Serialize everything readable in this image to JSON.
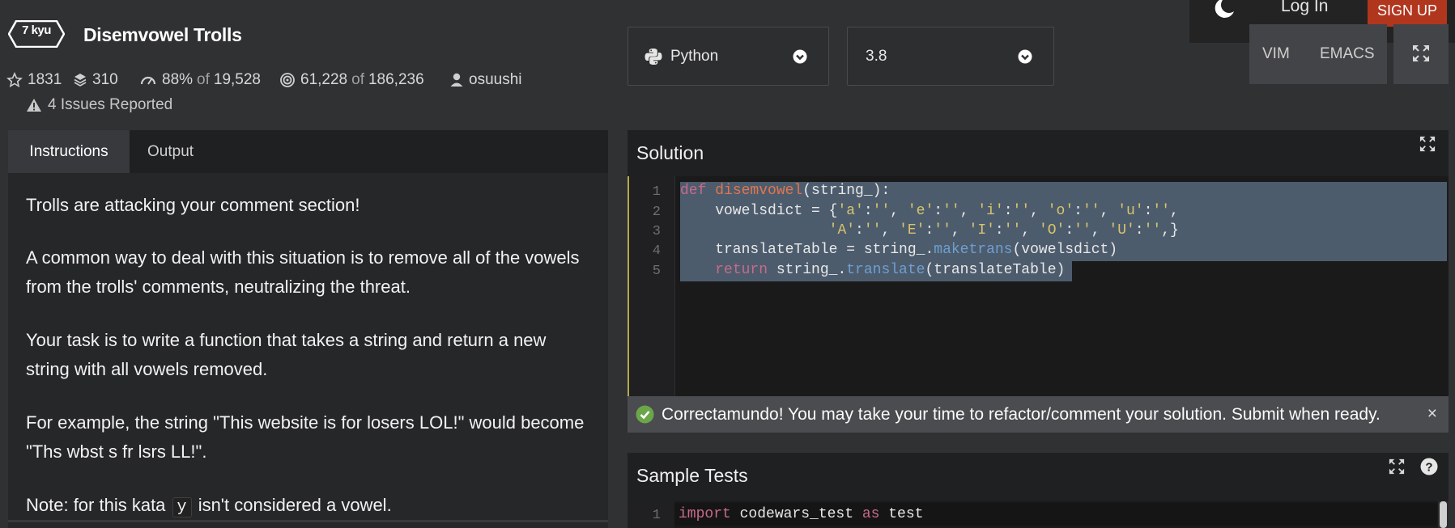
{
  "auth": {
    "login_label": "Log In",
    "signup_label": "SIGN UP",
    "theme_icon": "moon-icon"
  },
  "kata": {
    "rank": "7 kyu",
    "title": "Disemvowel Trolls",
    "stats": {
      "stars": "1831",
      "collections": "310",
      "satisfaction": "88%",
      "of1": "of",
      "votes": "19,528",
      "completed": "61,228",
      "of2": "of",
      "attempts": "186,236",
      "author": "osuushi"
    },
    "issues": "4 Issues Reported"
  },
  "language": {
    "selected": "Python",
    "version": "3.8"
  },
  "editor_modes": {
    "vim": "VIM",
    "emacs": "EMACS"
  },
  "tabs": {
    "instructions": "Instructions",
    "output": "Output"
  },
  "instructions": {
    "p1": "Trolls are attacking your comment section!",
    "p2a": "A common way to deal with this situation is to remove all of the vowels",
    "p2b": "from the trolls' comments, neutralizing the threat.",
    "p3a": "Your task is to write a function that takes a string and return a new",
    "p3b": "string with all vowels removed.",
    "p4a": "For example, the string \"This website is for losers LOL!\" would become",
    "p4b": "\"Ths wbst s fr lsrs LL!\".",
    "p5a": "Note: for this kata",
    "p5code": "y",
    "p5b": "isn't considered a vowel."
  },
  "solution": {
    "title": "Solution",
    "line_numbers": [
      "1",
      "2",
      "3",
      "4",
      "5"
    ],
    "code": {
      "l1_kw": "def",
      "l1_fn": "disemvowel",
      "l1_rest": "(string_):",
      "l2_a": "    vowelsdict = {",
      "l2_s1": "'a'",
      "l2_s2": "''",
      "l2_s3": "'e'",
      "l2_s4": "''",
      "l2_s5": "'i'",
      "l2_s6": "''",
      "l2_s7": "'o'",
      "l2_s8": "''",
      "l2_s9": "'u'",
      "l2_s10": "''",
      "l3_pad": "                 ",
      "l3_s1": "'A'",
      "l3_s2": "''",
      "l3_s3": "'E'",
      "l3_s4": "''",
      "l3_s5": "'I'",
      "l3_s6": "''",
      "l3_s7": "'O'",
      "l3_s8": "''",
      "l3_s9": "'U'",
      "l3_s10": "''",
      "l4_a": "    translateTable = string_.",
      "l4_m": "maketrans",
      "l4_b": "(vowelsdict)",
      "l5_pad": "    ",
      "l5_kw": "return",
      "l5_a": " string_.",
      "l5_m": "translate",
      "l5_b": "(translateTable)"
    }
  },
  "banner": {
    "text": "Correctamundo! You may take your time to refactor/comment your solution. Submit when ready.",
    "close": "×"
  },
  "sample_tests": {
    "title": "Sample Tests",
    "line_number": "1",
    "code_kw1": "import",
    "code_mid": " codewars_test ",
    "code_kw2": "as",
    "code_end": " test"
  },
  "colors": {
    "signup": "#b1361e",
    "success": "#6ca64a",
    "keyword": "#c76a8a",
    "function": "#e0764f",
    "string": "#d7c46c",
    "method": "#6e9fd0"
  }
}
